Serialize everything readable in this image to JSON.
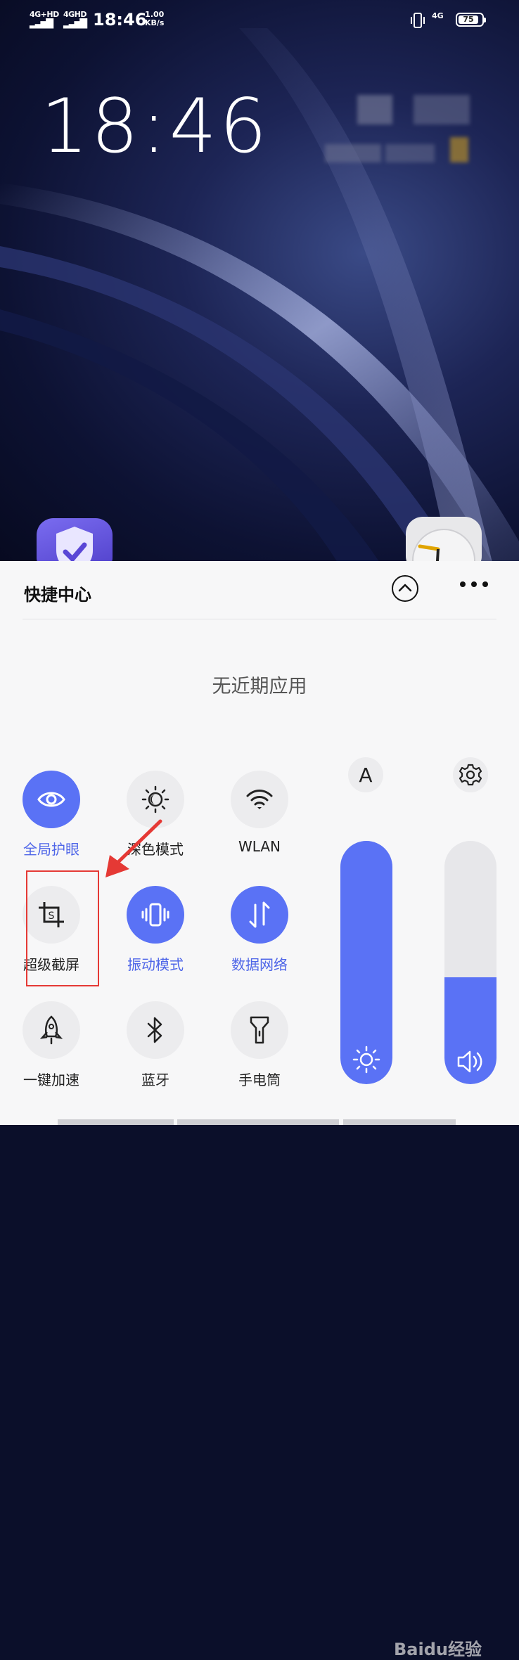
{
  "status_bar": {
    "signal1": "4G+HD",
    "signal2": "4GHD",
    "time": "18:46",
    "net_speed_value": "1.00",
    "net_speed_unit": "KB/s",
    "signal3": "4G",
    "battery": "75"
  },
  "lockscreen": {
    "clock": "18:46"
  },
  "quick_center": {
    "title": "快捷中心",
    "empty_text": "无近期应用",
    "tiles": [
      {
        "label": "全局护眼",
        "active": true,
        "icon": "eye-icon"
      },
      {
        "label": "深色模式",
        "active": false,
        "icon": "dark-mode-icon"
      },
      {
        "label": "WLAN",
        "active": false,
        "icon": "wifi-icon"
      },
      {
        "label": "超级截屏",
        "active": false,
        "icon": "screenshot-crop-icon"
      },
      {
        "label": "振动模式",
        "active": true,
        "icon": "vibrate-icon"
      },
      {
        "label": "数据网络",
        "active": true,
        "icon": "mobile-data-icon"
      },
      {
        "label": "一键加速",
        "active": false,
        "icon": "rocket-icon"
      },
      {
        "label": "蓝牙",
        "active": false,
        "icon": "bluetooth-icon"
      },
      {
        "label": "手电筒",
        "active": false,
        "icon": "flashlight-icon"
      }
    ],
    "auto_brightness_label": "A",
    "brightness_level": 1.0,
    "volume_level": 0.44
  },
  "watermark": "Baidu经验",
  "colors": {
    "accent": "#5a72f5",
    "annotation": "#e53935"
  }
}
